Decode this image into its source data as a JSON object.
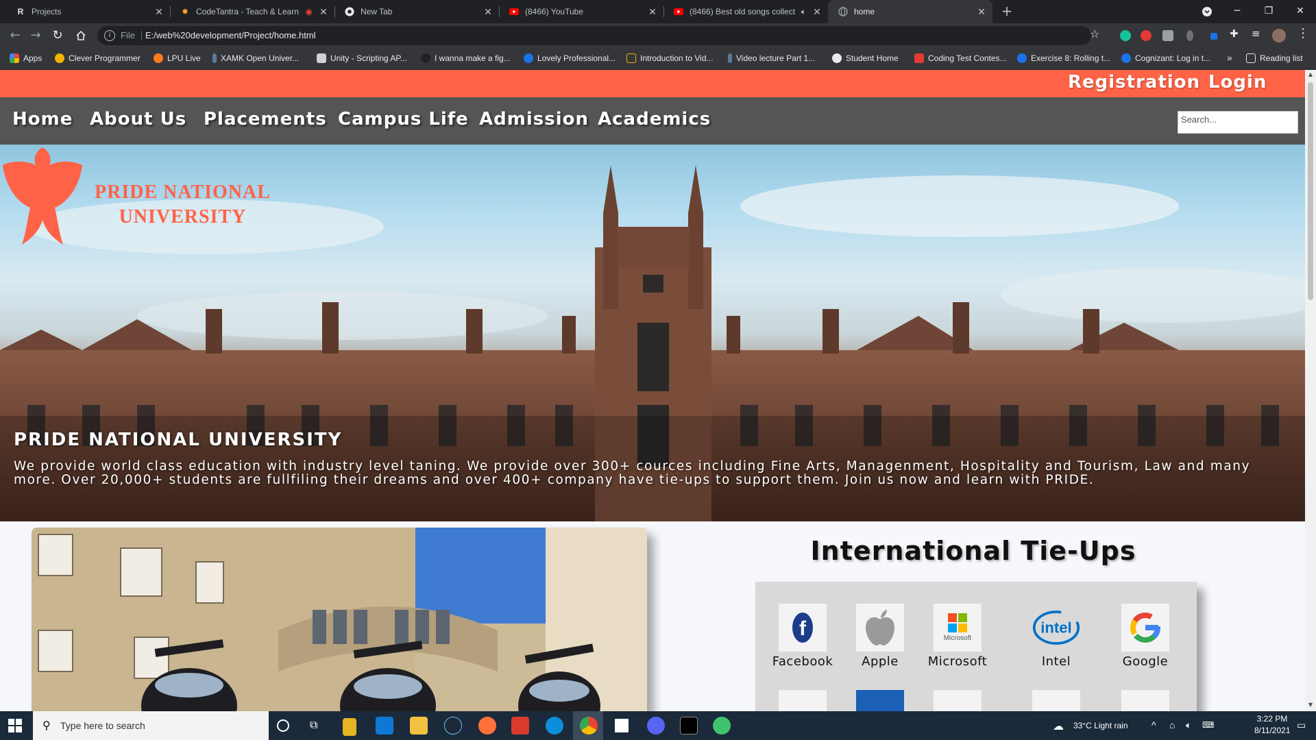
{
  "browser": {
    "tabs": [
      {
        "title": "Projects",
        "icon": "R"
      },
      {
        "title": "CodeTantra - Teach & Learn",
        "icon": "sun"
      },
      {
        "title": "New Tab",
        "icon": "chrome"
      },
      {
        "title": "(8466) YouTube",
        "icon": "youtube"
      },
      {
        "title": "(8466) Best old songs collect",
        "icon": "youtube"
      },
      {
        "title": "home",
        "icon": "globe"
      }
    ],
    "url_scheme": "File",
    "url": "E:/web%20development/Project/home.html",
    "bookmarks": [
      "Apps",
      "Clever Programmer",
      "LPU Live",
      "XAMK Open Univer...",
      "Unity - Scripting AP...",
      "I wanna make a fig...",
      "Lovely Professional...",
      "Introduction to Vid...",
      "Video lecture Part 1...",
      "Student Home",
      "Coding Test Contes...",
      "Exercise 8: Rolling t...",
      "Cognizant: Log in t..."
    ],
    "bookmarks_overflow": "»",
    "reading_list": "Reading list"
  },
  "page": {
    "topbar": {
      "registration": "Registration",
      "login": "Login"
    },
    "nav": [
      "Home",
      "About Us",
      "Placements",
      "Campus Life",
      "Admission",
      "Academics"
    ],
    "search_placeholder": "Search...",
    "logo_line1": "PRIDE NATIONAL",
    "logo_line2": "UNIVERSITY",
    "hero_title": "PRIDE NATIONAL UNIVERSITY",
    "hero_description": "We provide world class education with industry level taning. We provide over 300+ cources including Fine Arts, Managenment, Hospitality and Tourism, Law and many more. Over 20,000+ students are fullfiling their dreams and over 400+ company have tie-ups to support them. Join us now and learn with PRIDE.",
    "tieups_title": "International Tie-Ups",
    "companies": [
      "Facebook",
      "Apple",
      "Microsoft",
      "Intel",
      "Google"
    ],
    "colors": {
      "accent": "#ff6347",
      "nav_bg": "#555555"
    }
  },
  "taskbar": {
    "search_placeholder": "Type here to search",
    "weather": "33°C  Light rain",
    "time": "3:22 PM",
    "date": "8/11/2021"
  }
}
